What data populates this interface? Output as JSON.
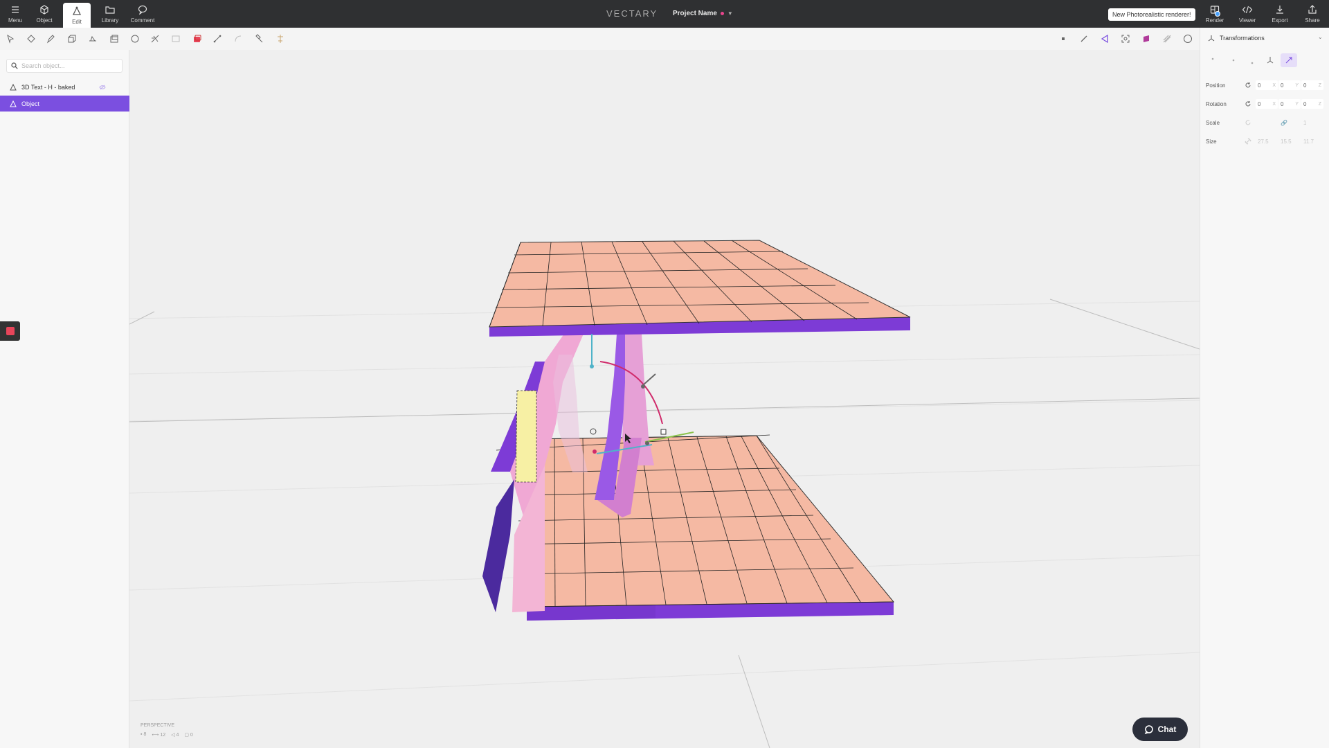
{
  "topbar": {
    "nav": [
      {
        "label": "Menu",
        "icon": "hamburger-icon"
      },
      {
        "label": "Object",
        "icon": "cube-icon"
      },
      {
        "label": "Edit",
        "icon": "edit-vertex-icon",
        "active": true
      },
      {
        "label": "Library",
        "icon": "folder-icon"
      },
      {
        "label": "Comment",
        "icon": "comment-icon"
      }
    ],
    "brand": "VECTARY",
    "project_name": "Project Name",
    "tooltip": "New Photorealistic renderer!",
    "actions": [
      {
        "label": "Render",
        "icon": "render-icon"
      },
      {
        "label": "Viewer",
        "icon": "code-icon"
      },
      {
        "label": "Export",
        "icon": "download-icon"
      },
      {
        "label": "Share",
        "icon": "share-icon"
      }
    ]
  },
  "left_panel": {
    "search_placeholder": "Search object...",
    "layers": [
      {
        "label": "3D Text - H - baked",
        "selected": false
      },
      {
        "label": "Object",
        "selected": true
      }
    ]
  },
  "viewport": {
    "camera": "PERSPECTIVE",
    "stats": {
      "vertices": "8",
      "edges": "12",
      "faces": "4",
      "objects": "0"
    }
  },
  "right_panel": {
    "title": "Transformations",
    "properties": [
      {
        "label": "Position",
        "x": "0",
        "y": "0",
        "z": "0"
      },
      {
        "label": "Rotation",
        "x": "0",
        "y": "0",
        "z": "0"
      },
      {
        "label": "Scale",
        "x": "",
        "y": "",
        "z": "1"
      },
      {
        "label": "Size",
        "x": "27.5",
        "y": "15.5",
        "z": "11.7"
      }
    ]
  },
  "chat_label": "Chat",
  "colors": {
    "accent": "#7b4fe0",
    "topbar": "#2f3032",
    "slab_top": "#f5b9a3",
    "slab_side": "#7d3bd6",
    "pillar_pink": "#f0a8d4",
    "pillar_purple": "#8a4de0",
    "highlight_face": "#f7f0a4"
  }
}
